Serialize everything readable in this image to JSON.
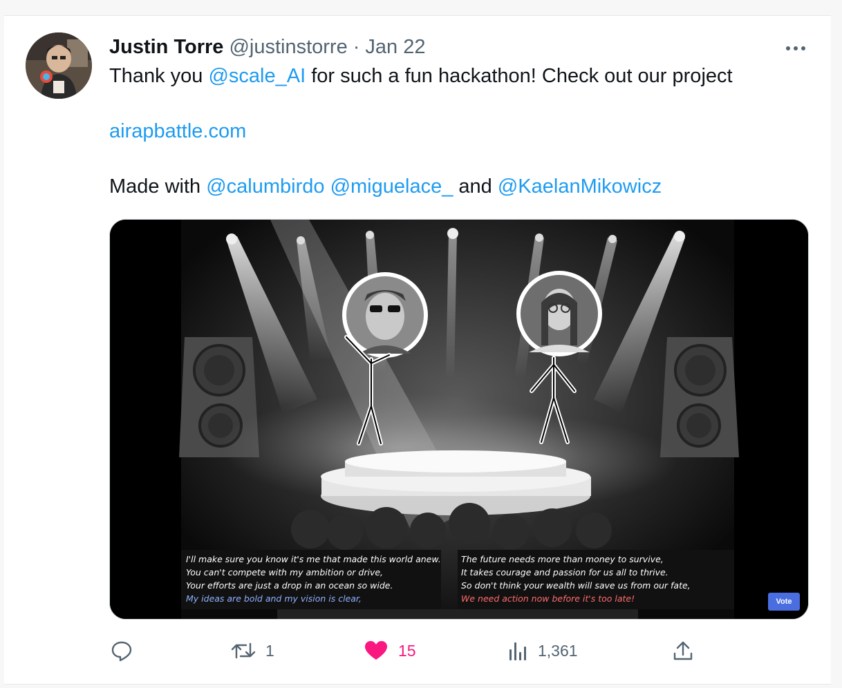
{
  "tweet": {
    "author_name": "Justin Torre",
    "handle": "@justinstorre",
    "separator": "·",
    "date": "Jan 22",
    "line1_prefix": "Thank you ",
    "line1_mention": "@scale_AI",
    "line1_suffix": " for such a fun hackathon! Check out our project",
    "link": "airapbattle.com",
    "line3_prefix": "Made with ",
    "mention_1": "@calumbirdo",
    "mention_2": "@miguelace_",
    "line3_and": " and ",
    "mention_3": "@KaelanMikowicz"
  },
  "media": {
    "left_verse": [
      "I'll make sure you know it's me that made this world anew.",
      "You can't compete with my ambition or drive,",
      "Your efforts are just a drop in an ocean so wide.",
      "My ideas are bold and my vision is clear,"
    ],
    "right_verse": [
      "The future needs more than money to survive,",
      "It takes courage and passion for us all to thrive.",
      "So don't think your wealth will save us from our fate,",
      "We need action now before it's too late!"
    ],
    "vote_label": "Vote",
    "highlight_colors": {
      "left": "#8fb1ff",
      "right": "#ff6b6b"
    }
  },
  "actions": {
    "reply_count": "",
    "retweet_count": "1",
    "like_count": "15",
    "views_count": "1,361"
  },
  "colors": {
    "link": "#1d9bf0",
    "like": "#f91880",
    "muted": "#536471"
  }
}
